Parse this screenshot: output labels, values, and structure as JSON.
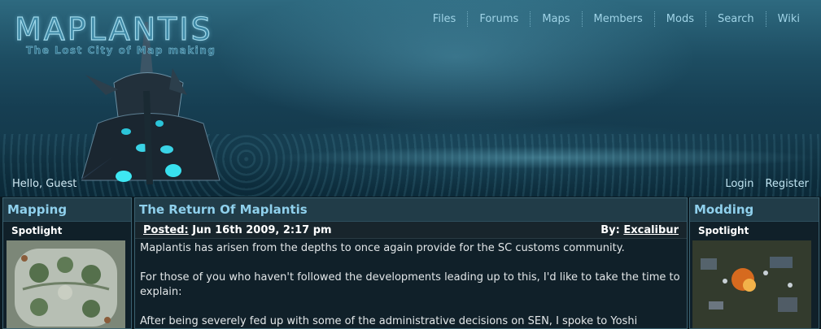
{
  "site": {
    "logo_text": "MAPLANTIS",
    "tagline": "The Lost City of Map making"
  },
  "nav": {
    "items": [
      {
        "label": "Files"
      },
      {
        "label": "Forums"
      },
      {
        "label": "Maps"
      },
      {
        "label": "Members"
      },
      {
        "label": "Mods"
      },
      {
        "label": "Search"
      },
      {
        "label": "Wiki"
      }
    ]
  },
  "user": {
    "greeting": "Hello, Guest",
    "login_label": "Login",
    "register_label": "Register"
  },
  "left_panel": {
    "title": "Mapping",
    "subtitle": "Spotlight"
  },
  "news": {
    "title": "The Return Of Maplantis",
    "posted_label": "Posted:",
    "posted_date": "Jun 16th 2009, 2:17 pm",
    "by_label": "By:",
    "author": "Excalibur",
    "paragraphs": [
      "Maplantis has arisen from the depths to once again provide for the SC customs community.",
      "For those of you who haven't followed the developments leading up to this, I'd like to take the time to explain:",
      "After being severely fed up with some of the administrative decisions on SEN, I spoke to Yoshi"
    ]
  },
  "right_panel": {
    "title": "Modding",
    "subtitle": "Spotlight"
  },
  "colors": {
    "accent": "#8fd0ec",
    "panel_bg": "#102029",
    "header_bg": "#213c48"
  }
}
